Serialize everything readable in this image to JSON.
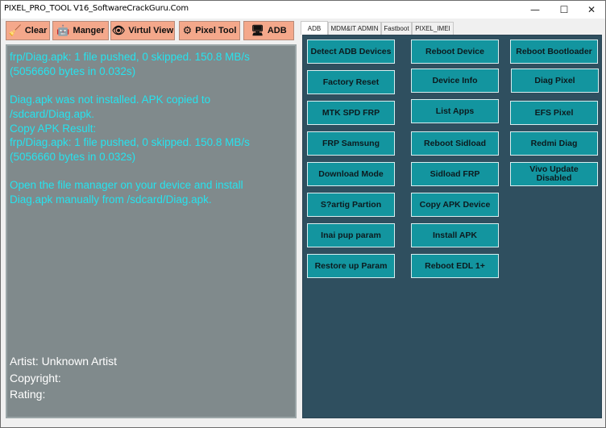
{
  "window": {
    "title": "PIXEL_PRO_TOOL V16_SoftwareCrackGuru.Com",
    "minimize_glyph": "—",
    "maximize_glyph": "☐",
    "close_glyph": "✕"
  },
  "toolbar": {
    "clear": "Clear",
    "manager": "Manger",
    "virtual_view": "Virtul View",
    "pixel_tool": "Pixel Tool",
    "adb": "ADB"
  },
  "console": {
    "log": "frp/Diag.apk: 1 file pushed, 0 skipped. 150.8 MB/s\n(5056660 bytes in 0.032s)\n\nDiag.apk was not installed. APK copied to\n/sdcard/Diag.apk.\nCopy APK Result:\nfrp/Diag.apk: 1 file pushed, 0 skipped. 150.8 MB/s\n(5056660 bytes in 0.032s)\n\nOpen the file manager on your device and install\nDiag.apk manually from /sdcard/Diag.apk.",
    "artist": "Artist: Unknown Artist",
    "copyright": "Copyright:",
    "rating": "Rating:"
  },
  "tabs": [
    "ADB",
    "MDM&IT ADMIN",
    "Fastboot",
    "PIXEL_IMEI"
  ],
  "buttons": {
    "detect_adb": "Detect ADB Devices",
    "reboot_device": "Reboot Device",
    "reboot_bootloader": "Reboot Bootloader",
    "factory_reset": "Factory Reset",
    "device_info": "Device Info",
    "diag_pixel": "Diag Pixel",
    "mtk_spd_frp": "MTK SPD FRP",
    "list_apps": "List Apps",
    "efs_pixel": "EFS Pixel",
    "frp_samsung": "FRP Samsung",
    "reboot_sidload": "Reboot Sidload",
    "redmi_diag": "Redmi Diag",
    "download_mode": "Download Mode",
    "sidload_frp": "Sidload FRP",
    "vivo_update_disabled": "Vivo Update Disabled",
    "startig_partion": "S?artig Partion",
    "copy_apk_device": "Copy APK  Device",
    "inai_pup_param": "Inai pup param",
    "install_apk": "Install APK",
    "restore_up_param": "Restore up Param",
    "reboot_edl": "Reboot EDL 1+"
  }
}
